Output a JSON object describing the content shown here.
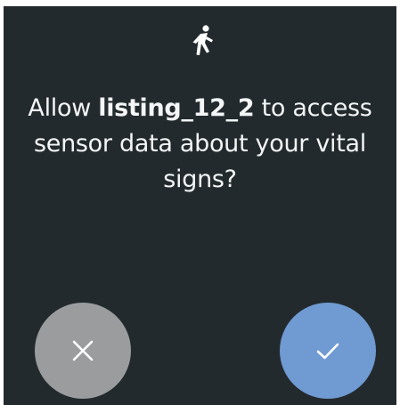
{
  "dialog": {
    "icon": "directions-walk-icon",
    "prompt_prefix": "Allow ",
    "app_name": "listing_12_2",
    "prompt_suffix": " to access sensor data about your vital signs?"
  },
  "actions": {
    "deny": {
      "icon": "close-icon",
      "color": "#9a9c9e"
    },
    "allow": {
      "icon": "check-icon",
      "color": "#6f9ad2"
    }
  },
  "colors": {
    "background": "#232a2e",
    "text": "#f3f5f6"
  }
}
